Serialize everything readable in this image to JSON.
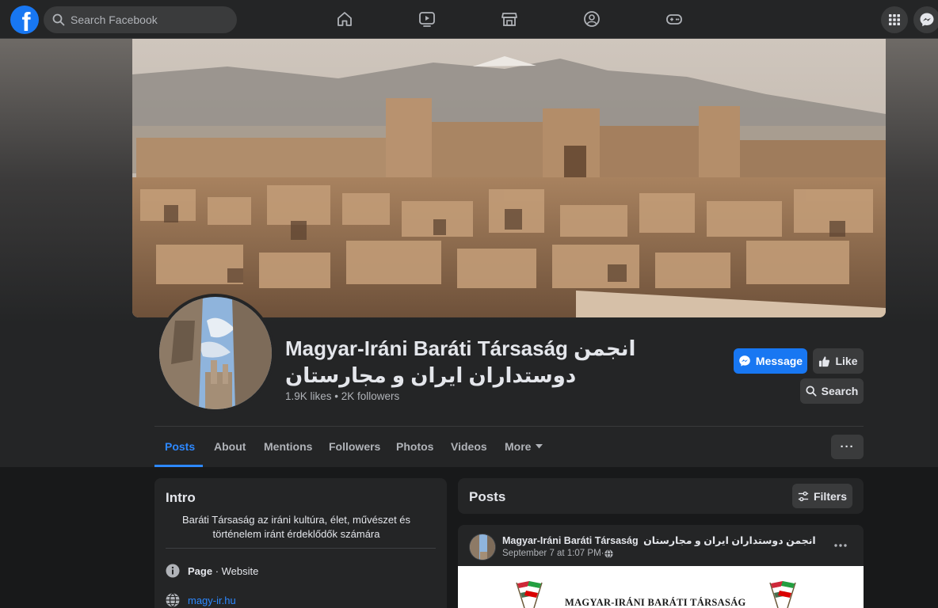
{
  "topbar": {
    "logo_letter": "f",
    "search_placeholder": "Search Facebook",
    "nav_icons": [
      "home-icon",
      "watch-icon",
      "marketplace-icon",
      "groups-icon",
      "gaming-icon"
    ],
    "right_icons": [
      "menu-grid-icon",
      "messenger-icon"
    ]
  },
  "page": {
    "title_line1": "Magyar-Iráni Baráti Társaság انجمن",
    "title_line2": "دوستداران ایران و مجارستان",
    "stats": "1.9K likes • 2K followers",
    "buttons": {
      "message": "Message",
      "like": "Like",
      "search": "Search"
    }
  },
  "tabs": [
    {
      "label": "Posts",
      "active": true
    },
    {
      "label": "About"
    },
    {
      "label": "Mentions"
    },
    {
      "label": "Followers"
    },
    {
      "label": "Photos"
    },
    {
      "label": "Videos"
    },
    {
      "label": "More"
    }
  ],
  "more_options_label": "···",
  "intro": {
    "title": "Intro",
    "description": "Baráti Társaság az iráni kultúra, élet, művészet és történelem iránt érdeklődők számára",
    "page_label": "Page",
    "page_category": " · Website",
    "website": "magy-ir.hu"
  },
  "posts": {
    "title": "Posts",
    "filters_label": "Filters",
    "first_post": {
      "author": "Magyar-Iráni Baráti Társaság",
      "author_rtl": "انجمن دوستداران ایران و مجارستان",
      "date": "September 7 at 1:07 PM",
      "privacy_separator": " · ",
      "image_text": "MAGYAR-IRÁNI BARÁTI TÁRSASÁG"
    }
  },
  "colors": {
    "accent": "#1877f2",
    "active_tab": "#2d88ff",
    "bg": "#18191a",
    "card": "#242526"
  }
}
